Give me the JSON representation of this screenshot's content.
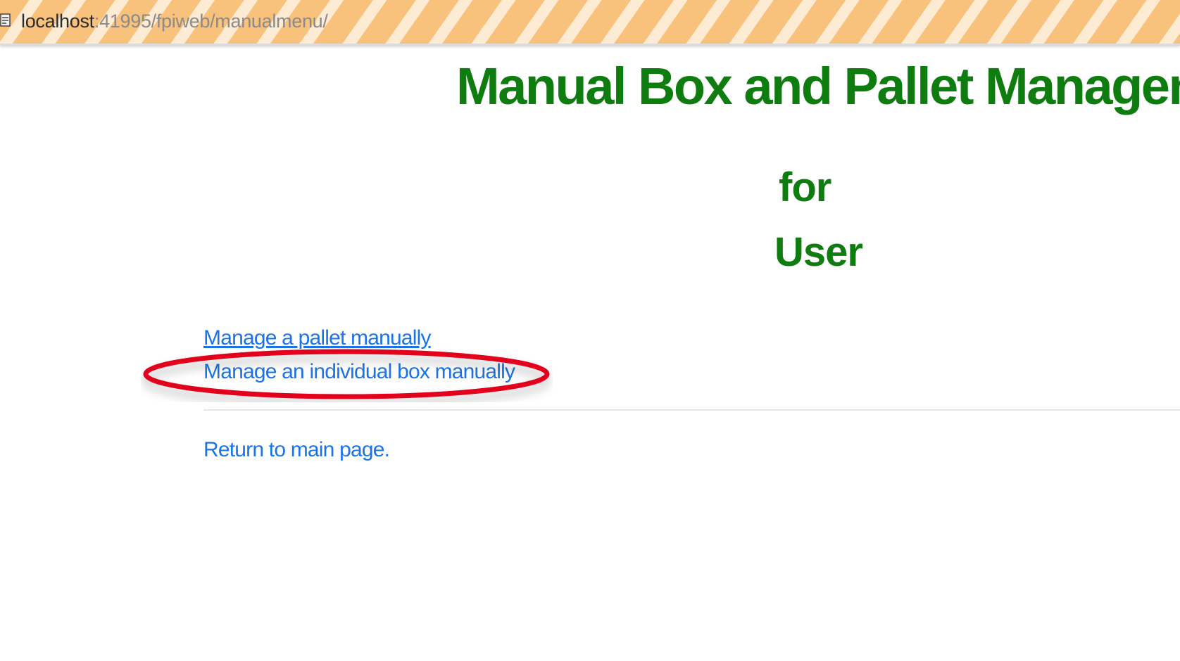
{
  "address_bar": {
    "host": "localhost",
    "path": ":41995/fpiweb/manualmenu/"
  },
  "header": {
    "title": "Manual Box and Pallet Management",
    "for_label": "for",
    "user_label": "User"
  },
  "menu": {
    "links": [
      {
        "label": "Manage a pallet manually"
      },
      {
        "label": "Manage an individual box manually"
      }
    ],
    "return_label": "Return to main page."
  },
  "colors": {
    "title": "#0f7c0f",
    "link": "#1a73e8",
    "annotation": "#e3001b"
  },
  "icons": {
    "site": "page-icon"
  }
}
